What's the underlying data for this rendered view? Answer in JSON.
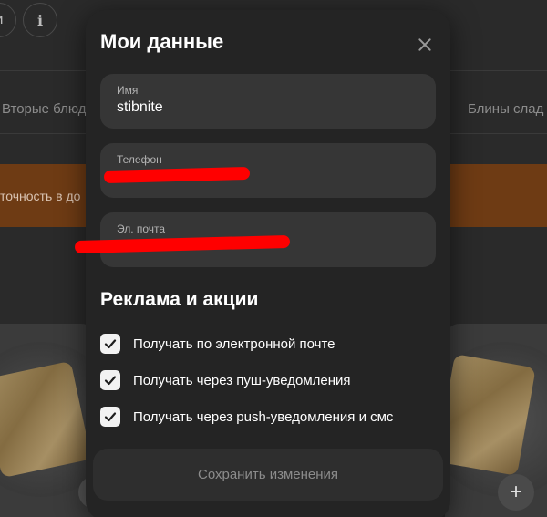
{
  "background": {
    "top_buttons": [
      {
        "icon": "user-icon",
        "glyph": "и"
      },
      {
        "icon": "info-icon",
        "glyph": "i"
      }
    ],
    "categories": [
      "Вторые блюд",
      "Блины слад"
    ],
    "promo_text": "точность в до",
    "add_button_glyph": "+"
  },
  "modal": {
    "title": "Мои данные",
    "close_icon": "close-icon",
    "fields": [
      {
        "label": "Имя",
        "value": "stibnite"
      },
      {
        "label": "Телефон",
        "value": "",
        "redacted": true
      },
      {
        "label": "Эл. почта",
        "value": "",
        "redacted": true
      }
    ],
    "promo_section": {
      "title": "Реклама и акции",
      "options": [
        {
          "label": "Получать по электронной почте",
          "checked": true
        },
        {
          "label": "Получать через пуш-уведомления",
          "checked": true
        },
        {
          "label": "Получать через push-уведомления и смс",
          "checked": true
        }
      ]
    },
    "save_label": "Сохранить изменения"
  },
  "colors": {
    "modal_bg": "#242424",
    "field_bg": "#363636",
    "redaction": "#ff0000",
    "promo_banner": "#6e3b14"
  }
}
